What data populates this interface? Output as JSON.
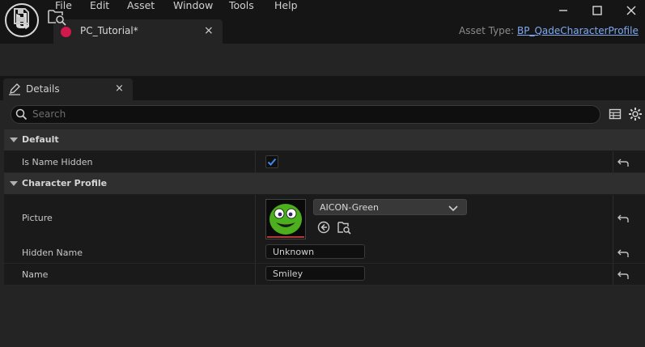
{
  "menu": [
    "File",
    "Edit",
    "Asset",
    "Window",
    "Tools",
    "Help"
  ],
  "document_tab": {
    "label": "PC_Tutorial*",
    "close": "×"
  },
  "asset_type": {
    "label": "Asset Type:",
    "value": "BP_QadeCharacterProfile"
  },
  "details_tab": {
    "label": "Details",
    "close": "×"
  },
  "search": {
    "placeholder": "Search",
    "value": ""
  },
  "categories": [
    {
      "label": "Default"
    },
    {
      "label": "Character Profile"
    }
  ],
  "properties": {
    "is_name_hidden": {
      "label": "Is Name Hidden",
      "checked": true
    },
    "picture": {
      "label": "Picture",
      "asset": "AICON-Green"
    },
    "hidden_name": {
      "label": "Hidden Name",
      "value": "Unknown"
    },
    "name": {
      "label": "Name",
      "value": "Smiley"
    }
  },
  "colors": {
    "accent": "#7fa9f0",
    "tab_dot": "#d0194d",
    "checkbox": "#3d8cf0"
  }
}
